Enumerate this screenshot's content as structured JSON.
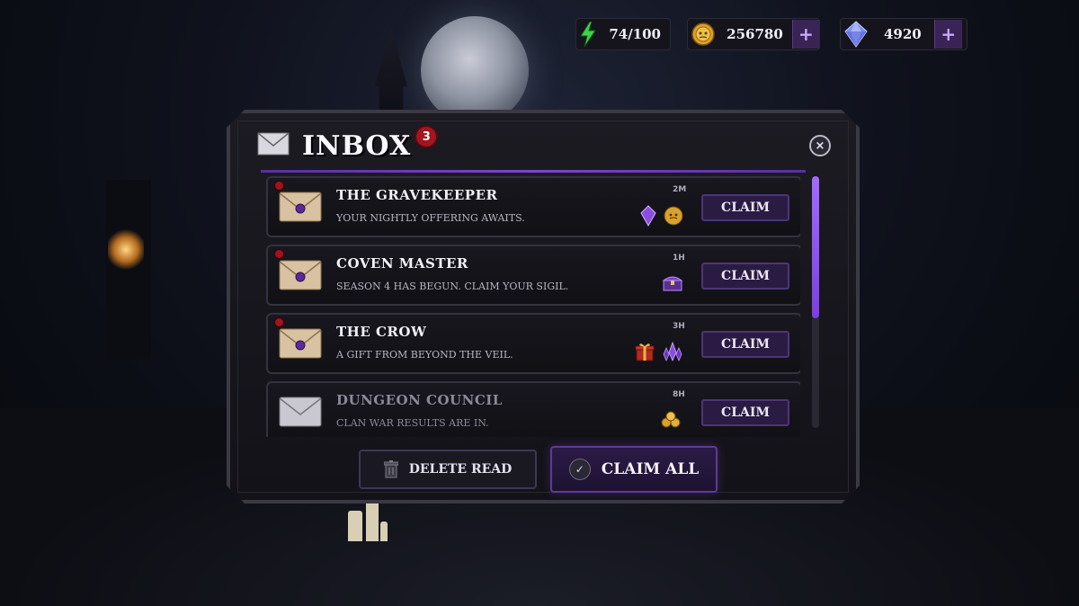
{
  "topbar": {
    "energy": {
      "value": "74/100",
      "icon": "lightning-icon",
      "color": "#3fd24a"
    },
    "gold": {
      "value": "256780",
      "icon": "coin-icon"
    },
    "gems": {
      "value": "4920",
      "icon": "diamond-icon"
    },
    "plus_label": "+"
  },
  "inbox": {
    "title": "INBOX",
    "unread_count": "3",
    "close_label": "×",
    "messages": [
      {
        "sender": "THE GRAVEKEEPER",
        "subject": "YOUR NIGHTLY OFFERING AWAITS.",
        "time": "2M",
        "unread": true,
        "rewards": [
          "purple-gem-icon",
          "gold-coin-icon"
        ],
        "claim_label": "CLAIM"
      },
      {
        "sender": "COVEN MASTER",
        "subject": "SEASON 4 HAS BEGUN. CLAIM YOUR SIGIL.",
        "time": "1H",
        "unread": true,
        "rewards": [
          "treasure-chest-icon"
        ],
        "claim_label": "CLAIM"
      },
      {
        "sender": "THE CROW",
        "subject": "A GIFT FROM BEYOND THE VEIL.",
        "time": "3H",
        "unread": true,
        "rewards": [
          "gift-box-icon",
          "crystal-cluster-icon"
        ],
        "claim_label": "CLAIM"
      },
      {
        "sender": "DUNGEON COUNCIL",
        "subject": "CLAN WAR RESULTS ARE IN.",
        "time": "8H",
        "unread": false,
        "rewards": [
          "gold-pile-icon"
        ],
        "claim_label": "CLAIM"
      }
    ],
    "delete_read_label": "DELETE READ",
    "claim_all_label": "CLAIM ALL",
    "accent_color": "#7a45d0"
  }
}
